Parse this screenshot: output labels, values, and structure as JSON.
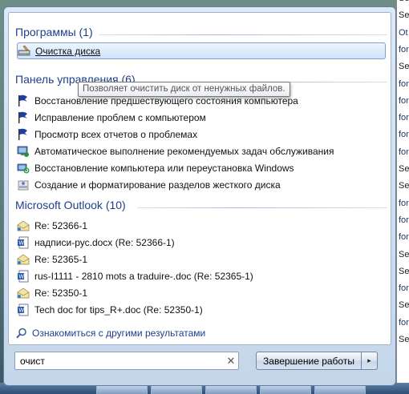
{
  "background_window": {
    "lines": [
      "Security U",
      "Security U",
      "Ot",
      "for",
      "Security U",
      "for",
      "for",
      "for",
      "for",
      "for",
      "Security U",
      "Security U",
      "for",
      "for",
      "for",
      "Security U",
      "Security U",
      "for",
      "Security U",
      "for",
      "Security U"
    ]
  },
  "start_menu": {
    "programs": {
      "header": "Программы (1)",
      "items": [
        {
          "label": "Очистка диска",
          "icon": "disk-cleanup-icon",
          "selected": true
        }
      ]
    },
    "tooltip": "Позволяет очистить диск от ненужных файлов.",
    "control_panel": {
      "header": "Панель управления (6)",
      "items": [
        {
          "label": "Восстановление предшествующего состояния компьютера",
          "icon": "action-center-flag-icon"
        },
        {
          "label": "Исправление проблем с компьютером",
          "icon": "action-center-flag-icon"
        },
        {
          "label": "Просмотр всех отчетов о проблемах",
          "icon": "action-center-flag-icon"
        },
        {
          "label": "Автоматическое выполнение рекомендуемых задач обслуживания",
          "icon": "maintenance-icon"
        },
        {
          "label": "Восстановление компьютера или переустановка Windows",
          "icon": "recovery-icon"
        },
        {
          "label": "Создание и форматирование разделов жесткого диска",
          "icon": "disk-management-icon"
        }
      ]
    },
    "outlook": {
      "header": "Microsoft Outlook (10)",
      "items": [
        {
          "label": "Re: 52366-1",
          "icon": "mail-open-icon"
        },
        {
          "label": "надписи-рус.docx (Re: 52366-1)",
          "icon": "word-doc-icon"
        },
        {
          "label": "Re: 52365-1",
          "icon": "mail-open-icon"
        },
        {
          "label": "rus-I1111 - 2810 mots a traduire-.doc (Re: 52365-1)",
          "icon": "word-doc-icon"
        },
        {
          "label": "Re: 52350-1",
          "icon": "mail-open-icon"
        },
        {
          "label": "Tech doc for tips_R+.doc (Re: 52350-1)",
          "icon": "word-doc-icon"
        }
      ]
    },
    "more_results": "Ознакомиться с другими результатами",
    "search": {
      "value": "очист",
      "clear_icon": "clear-x-icon"
    },
    "shutdown": {
      "label": "Завершение работы",
      "arrow": "▸"
    }
  },
  "colors": {
    "header_blue": "#1e3f8a",
    "selection": "#cfe3fb",
    "flag_blue": "#1c3e9c"
  }
}
